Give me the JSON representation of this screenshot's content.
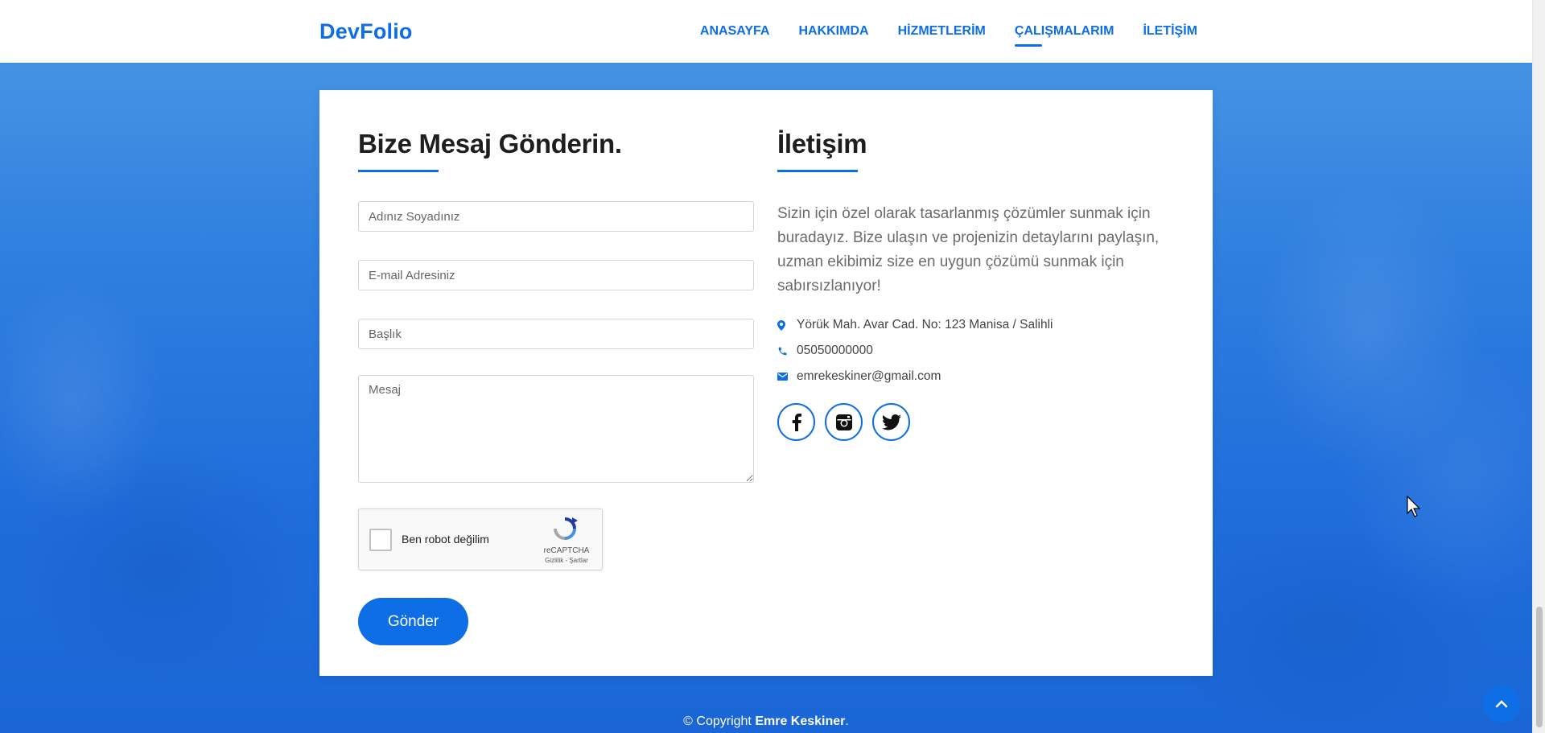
{
  "brand": {
    "logo": "DevFolio"
  },
  "nav": {
    "items": [
      {
        "label": "ANASAYFA"
      },
      {
        "label": "HAKKIMDA"
      },
      {
        "label": "HİZMETLERİM"
      },
      {
        "label": "ÇALIŞMALARIM",
        "active": true
      },
      {
        "label": "İLETİŞİM"
      }
    ]
  },
  "form": {
    "title": "Bize Mesaj Gönderin.",
    "name_placeholder": "Adınız Soyadınız",
    "email_placeholder": "E-mail Adresiniz",
    "subject_placeholder": "Başlık",
    "message_placeholder": "Mesaj",
    "recaptcha": {
      "label": "Ben robot değilim",
      "brand": "reCAPTCHA",
      "terms": "Gizlilik - Şartlar"
    },
    "submit_label": "Gönder"
  },
  "contact": {
    "title": "İletişim",
    "text": "Sizin için özel olarak tasarlanmış çözümler sunmak için buradayız. Bize ulaşın ve projenizin detaylarını paylaşın, uzman ekibimiz size en uygun çözümü sunmak için sabırsızlanıyor!",
    "address": "Yörük Mah. Avar Cad. No: 123 Manisa / Salihli",
    "phone": "05050000000",
    "email": "emrekeskiner@gmail.com",
    "socials": [
      "facebook-icon",
      "instagram-icon",
      "twitter-icon"
    ]
  },
  "footer": {
    "copyright_prefix": "© Copyright",
    "author": "Emre Keskiner",
    "suffix": "."
  },
  "colors": {
    "accent": "#0d6ee6",
    "text": "#1e1e1e",
    "muted": "#6b6b6b"
  }
}
